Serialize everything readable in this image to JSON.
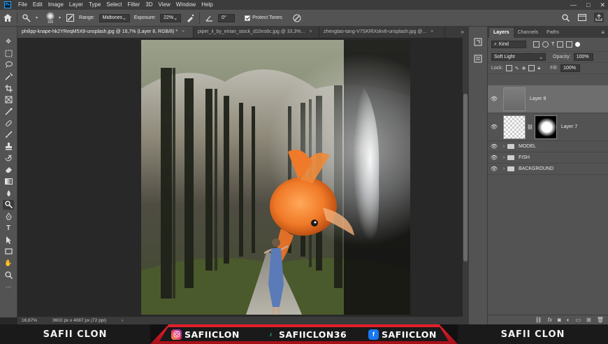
{
  "app": {
    "logo": "Ps"
  },
  "menu": [
    "File",
    "Edit",
    "Image",
    "Layer",
    "Type",
    "Select",
    "Filter",
    "3D",
    "View",
    "Window",
    "Help"
  ],
  "window_controls": {
    "minimize": "—",
    "maximize": "□",
    "close": "✕"
  },
  "options": {
    "brush_size": "100",
    "range_label": "Range:",
    "range_value": "Midtones",
    "exposure_label": "Exposure:",
    "exposure_value": "22%",
    "angle_value": "0°",
    "protect_tones_label": "Protect Tones"
  },
  "tabs": [
    {
      "label": "philipp-knape-hk2YReqM5X8-unsplash.jpg @ 16,7% (Layer 8, RGB/8) *",
      "close": "×"
    },
    {
      "label": "piper_ii_by_eirian_stock_d10ns6c.jpg @ 33,3%...",
      "close": "×"
    },
    {
      "label": "zhengtao-tang-V7SKRlXskv8-unsplash.jpg @...",
      "close": "×"
    }
  ],
  "status": {
    "zoom": "16,67%",
    "doc_info": "3602 px x 4087 px (72 ppi)"
  },
  "layers_panel": {
    "tabs": [
      "Layers",
      "Channels",
      "Paths"
    ],
    "filter_kind": "Kind",
    "blend_mode": "Soft Light",
    "opacity_label": "Opacity:",
    "opacity_value": "100%",
    "lock_label": "Lock:",
    "fill_label": "Fill:",
    "fill_value": "100%",
    "layers": [
      {
        "name": "Layer 8",
        "type": "layer",
        "selected": true
      },
      {
        "name": "Layer 7",
        "type": "layer-mask",
        "selected": false
      },
      {
        "name": "MODEL",
        "type": "group"
      },
      {
        "name": "FISH",
        "type": "group"
      },
      {
        "name": "BACKGROUND",
        "type": "group"
      }
    ],
    "footer_icons": [
      "link-icon",
      "fx-icon",
      "mask-icon",
      "adjustment-icon",
      "folder-icon",
      "new-layer-icon",
      "trash-icon"
    ]
  },
  "banner": {
    "left": "SAFII CLON",
    "right": "SAFII CLON",
    "instagram": "SAFIICLON",
    "tiktok": "SAFIICLON36",
    "facebook": "SAFIICLON"
  },
  "colors": {
    "accent_red": "#e8202c",
    "foreground": "#ffffff",
    "background": "#000000"
  }
}
